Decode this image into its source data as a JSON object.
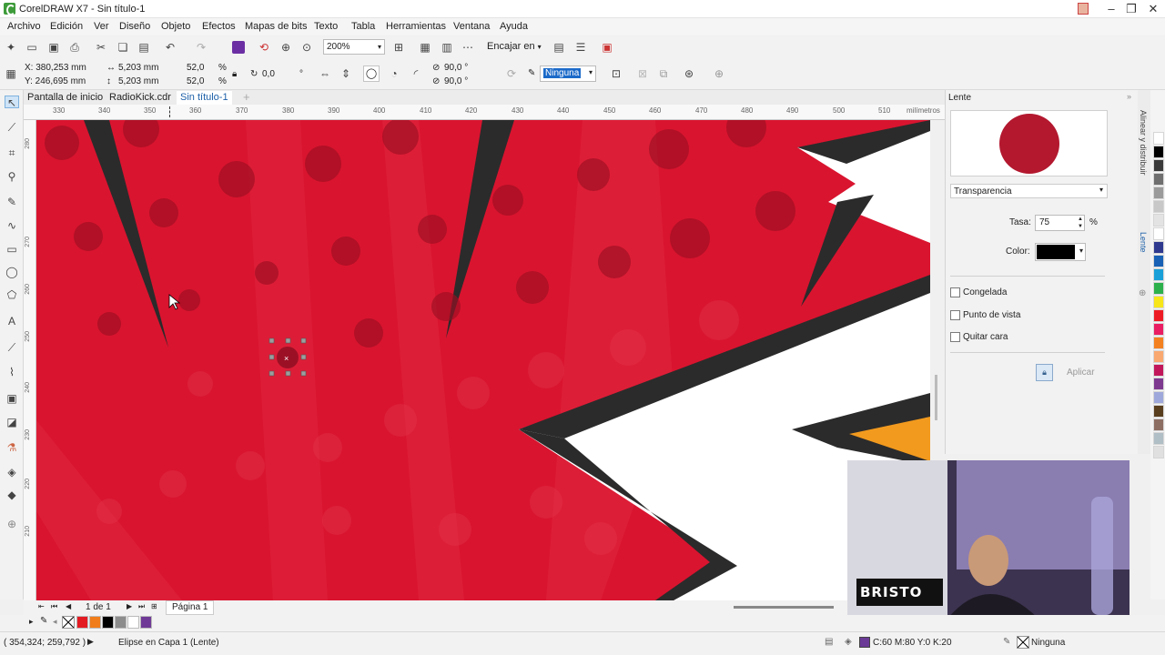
{
  "window": {
    "title": "CorelDRAW X7 - Sin título-1",
    "controls": [
      "minimize-icon",
      "maximize-icon",
      "close-icon"
    ]
  },
  "menu": [
    "Archivo",
    "Edición",
    "Ver",
    "Diseño",
    "Objeto",
    "Efectos",
    "Mapas de bits",
    "Texto",
    "Tabla",
    "Herramientas",
    "Ventana",
    "Ayuda"
  ],
  "standard_toolbar": {
    "zoom": "200%",
    "snap_to": "Encajar en"
  },
  "property_bar": {
    "x": "X: 380,253 mm",
    "y": "Y: 246,695 mm",
    "width": "5,203 mm",
    "height": "5,203 mm",
    "scale_w": "52,0",
    "scale_h": "52,0",
    "percent": "%",
    "rotation": "0,0",
    "degree": "°",
    "start_angle": "90,0 °",
    "end_angle": "90,0 °",
    "outline": "Ninguna"
  },
  "doc_tabs": [
    "Pantalla de inicio",
    "RadioKick.cdr",
    "Sin título-1"
  ],
  "active_tab": 2,
  "ruler": {
    "top": [
      "330",
      "340",
      "350",
      "360",
      "370",
      "380",
      "390",
      "400",
      "410",
      "420",
      "430",
      "440",
      "450",
      "460",
      "470",
      "480",
      "490",
      "500",
      "510"
    ],
    "unit": "milímetros",
    "left": [
      "280",
      "270",
      "260",
      "250",
      "240",
      "230",
      "220",
      "210"
    ]
  },
  "docker": {
    "title": "Lente",
    "lens_type": "Transparencia",
    "rate_label": "Tasa:",
    "rate_value": "75",
    "rate_unit": "%",
    "color_label": "Color:",
    "frozen": "Congelada",
    "viewpoint": "Punto de vista",
    "remove_face": "Quitar cara",
    "apply": "Aplicar",
    "colors": {
      "preview_circle": "#b3182f",
      "lens_color": "#000000"
    }
  },
  "side_tabs": [
    "Alinear y distribuir",
    "Lente"
  ],
  "page_nav": {
    "counter": "1 de 1",
    "page_tab": "Página 1"
  },
  "status": {
    "coords": "( 354,324; 259,792 )",
    "object": "Elipse en Capa 1  (Lente)",
    "fill": "C:60 M:80 Y:0 K:20",
    "outline": "Ninguna"
  },
  "webcam": {
    "logo": "BRISTO"
  },
  "palette_colors": [
    "#ffffff",
    "#000000",
    "#3a3a3a",
    "#6f6f6f",
    "#9b9b9b",
    "#c8c8c8",
    "#e3e3e3",
    "#ffffff",
    "#2f3a8f",
    "#1a62b5",
    "#1aa0d8",
    "#2db14c",
    "#f7e61a",
    "#ed1c24",
    "#e91e63",
    "#f48120",
    "#f9a870",
    "#c2185b",
    "#7e3a8f",
    "#9fa8da",
    "#5a3f1f",
    "#8d6e63",
    "#b0bec5",
    "#e0e0e0"
  ],
  "bottom_palette": [
    "#e31b23",
    "#f07d1a",
    "#000000",
    "#8c8c8c",
    "#ffffff",
    "#6f3a96"
  ]
}
